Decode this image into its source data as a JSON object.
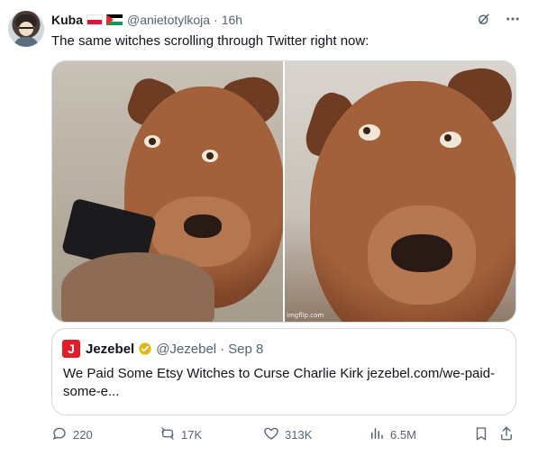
{
  "tweet": {
    "author_name": "Kuba",
    "flags": [
      "flag-poland-icon",
      "flag-palestine-icon"
    ],
    "handle": "@anietotylkoja",
    "dot": "·",
    "time": "16h",
    "text": "The same witches scrolling through Twitter right now:",
    "top_icons": [
      "grok-icon",
      "more-icon"
    ],
    "media": {
      "images": [
        "dog-looking-at-phone",
        "shocked-dog-stare"
      ],
      "watermark": "imgflip.com"
    },
    "quote": {
      "logo_letter": "J",
      "name": "Jezebel",
      "verified_icon": "verified-badge-icon",
      "handle": "@Jezebel",
      "dot": "·",
      "time": "Sep 8",
      "text": "We Paid Some Etsy Witches to Curse Charlie Kirk jezebel.com/we-paid-some-e..."
    },
    "actions": {
      "replies": "220",
      "reposts": "17K",
      "likes": "313K",
      "views": "6.5M"
    }
  },
  "colors": {
    "text_primary": "#0f1419",
    "text_secondary": "#536471",
    "border": "#cfd9de",
    "jezebel_red": "#e11d2a",
    "verified_gold": "#e2b719"
  }
}
